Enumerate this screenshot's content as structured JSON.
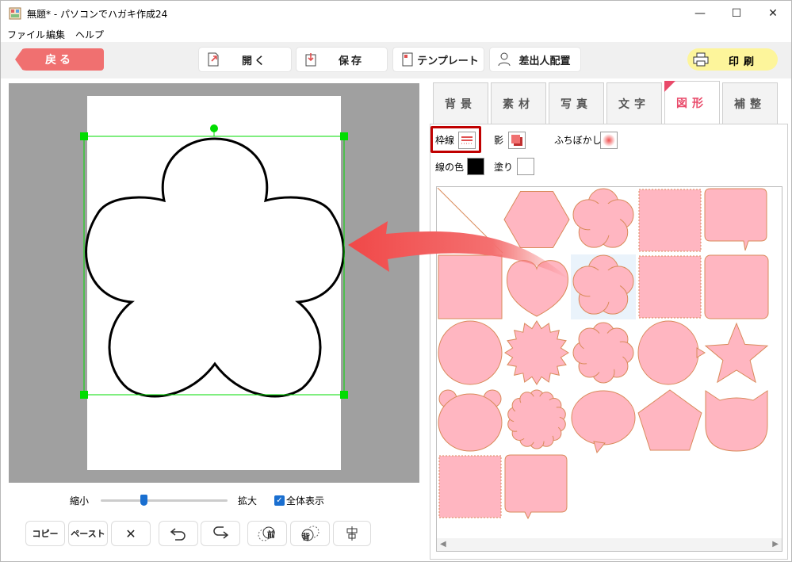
{
  "window": {
    "title": "無題* - パソコンでハガキ作成24",
    "minimize_glyph": "—",
    "maximize_glyph": "☐",
    "close_glyph": "✕"
  },
  "menu": [
    "ファイル",
    "編集",
    "ヘルプ"
  ],
  "toolbar": {
    "back_label": "戻る",
    "open_label": "開く",
    "save_label": "保存",
    "template_label": "テンプレート",
    "sender_label": "差出人配置",
    "print_label": "印刷"
  },
  "tabs": [
    "背景",
    "素材",
    "写真",
    "文字",
    "図形",
    "補整"
  ],
  "active_tab": "図形",
  "options": {
    "border_label": "枠線",
    "shadow_label": "影",
    "blur_label": "ふちぼかし",
    "line_color_label": "線の色",
    "fill_label": "塗り",
    "line_color": "#000000",
    "fill_color": "#ffffff"
  },
  "zoom": {
    "shrink_label": "縮小",
    "enlarge_label": "拡大",
    "fit_label": "全体表示",
    "fit_checked": true,
    "level": 0.34
  },
  "bottom_buttons": {
    "copy_label": "コピー",
    "paste_label": "ペースト",
    "delete_glyph": "✕",
    "front_glyph": "前",
    "back_glyph": "背"
  },
  "colors": {
    "accent_red": "#f07070",
    "shape_fill": "#ffb6c1",
    "shape_stroke": "#d98a5a",
    "selection": "#00dd00",
    "print_yellow": "#fdf59b",
    "tab_active_text": "#e94a6a",
    "highlight_box": "#c00000"
  },
  "shapes": [
    "none",
    "hexagon",
    "sakura",
    "square-zigzag",
    "speech-rect-tail",
    "square",
    "heart",
    "plum-flower",
    "square-scallop",
    "rounded-square",
    "circle",
    "burst",
    "flower-scallop",
    "speech-oval-right",
    "star",
    "bear-face",
    "chrysanthemum",
    "speech-oval-bottom",
    "pentagon",
    "cat-face",
    "square-stamp",
    "speech-rect-bottom"
  ],
  "selected_shape": "plum-flower"
}
